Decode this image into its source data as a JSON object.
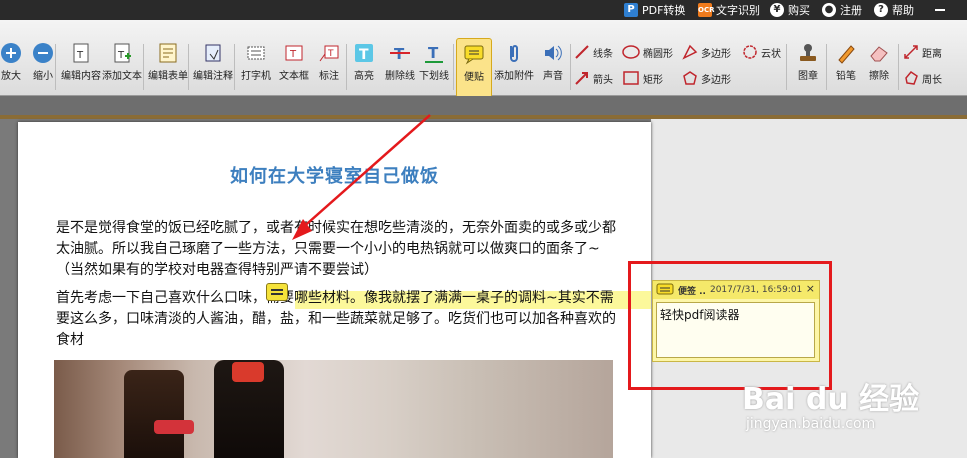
{
  "topbar": {
    "pdf_convert": "PDF转换",
    "ocr": "文字识别",
    "buy": "购买",
    "register": "注册",
    "help": "帮助"
  },
  "toolbar": {
    "tools": [
      {
        "key": "zoom-in",
        "label": "放大"
      },
      {
        "key": "zoom-out",
        "label": "缩小"
      },
      {
        "key": "edit-content",
        "label": "编辑内容"
      },
      {
        "key": "add-text",
        "label": "添加文本"
      },
      {
        "key": "edit-form",
        "label": "编辑表单"
      },
      {
        "key": "edit-annot",
        "label": "编辑注释"
      },
      {
        "key": "typewriter",
        "label": "打字机"
      },
      {
        "key": "textbox",
        "label": "文本框"
      },
      {
        "key": "callout",
        "label": "标注"
      },
      {
        "key": "highlight",
        "label": "高亮"
      },
      {
        "key": "strikethrough",
        "label": "删除线"
      },
      {
        "key": "underline",
        "label": "下划线"
      },
      {
        "key": "sticky-note",
        "label": "便贴"
      },
      {
        "key": "attachment",
        "label": "添加附件"
      },
      {
        "key": "sound",
        "label": "声音"
      },
      {
        "key": "stamp",
        "label": "图章"
      },
      {
        "key": "pencil",
        "label": "铅笔"
      },
      {
        "key": "eraser",
        "label": "擦除"
      }
    ],
    "shapes": {
      "line": "线条",
      "ellipse": "椭圆形",
      "polygon": "多边形",
      "cloud": "云状",
      "arrow": "箭头",
      "rect": "矩形",
      "polyline": "多边形",
      "distance": "距离",
      "perimeter": "周长"
    }
  },
  "document": {
    "title": "如何在大学寝室自己做饭",
    "paragraph1": "是不是觉得食堂的饭已经吃腻了，或者有时候实在想吃些清淡的，无奈外面卖的或多或少都太油腻。所以我自己琢磨了一些方法，只需要一个小小的电热锅就可以做爽口的面条了~（当然如果有的学校对电器查得特别严请不要尝试）",
    "paragraph2": "首先考虑一下自己喜欢什么口味，需要哪些材料。像我就摆了满满一桌子的调料~其实不需要这么多，口味清淡的人酱油，醋，盐，和一些蔬菜就足够了。吃货们也可以加各种喜欢的食材"
  },
  "note": {
    "title": "便签 ..",
    "timestamp": "2017/7/31, 16:59:01",
    "close": "×",
    "content": "轻快pdf阅读器"
  },
  "watermark": {
    "main": "Bai du 经验",
    "sub": "jingyan.baidu.com"
  },
  "colors": {
    "title_blue": "#3d7fbf",
    "highlight": "#fbf78a",
    "note_bg": "#fdf6a8",
    "red_box": "#e4191c"
  }
}
